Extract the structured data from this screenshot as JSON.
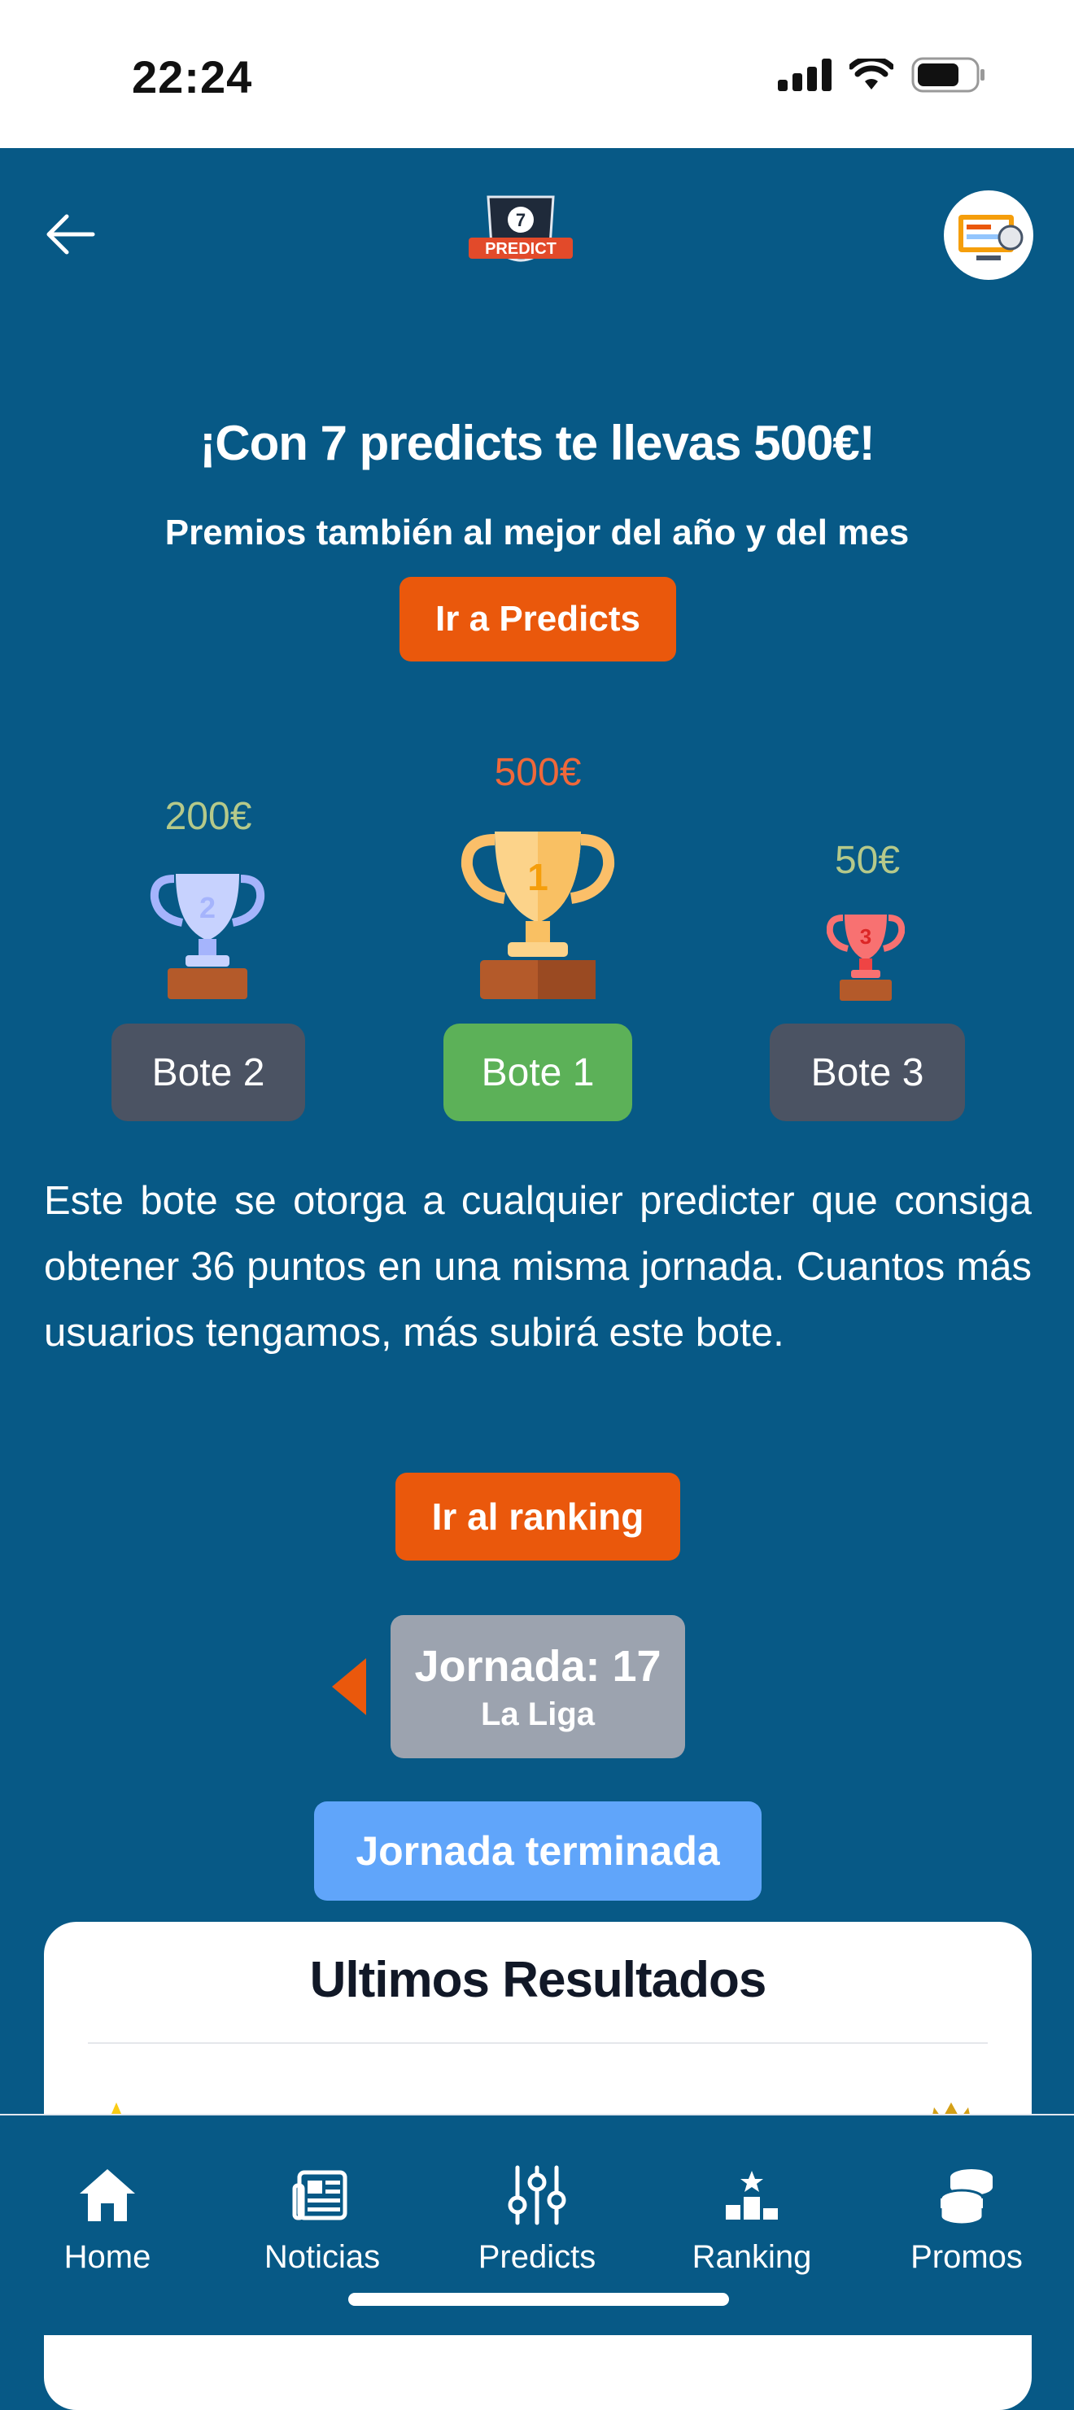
{
  "status_bar": {
    "time": "22:24"
  },
  "header": {
    "back_icon": "arrow-left-icon",
    "logo_text": "PREDICT",
    "logo_number": "7",
    "avatar_icon": "user-avatar-icon"
  },
  "promo": {
    "headline": "¡Con 7 predicts te llevas 500€!",
    "subline": "Premios también al mejor del año y del mes",
    "predicts_button": "Ir a Predicts"
  },
  "prizes": [
    {
      "amount": "200€",
      "label": "Bote 2",
      "rank": "2"
    },
    {
      "amount": "500€",
      "label": "Bote 1",
      "rank": "1"
    },
    {
      "amount": "50€",
      "label": "Bote 3",
      "rank": "3"
    }
  ],
  "selected_bote": "Bote 1",
  "description": "Este bote se otorga a cualquier predicter que consiga obtener 36 puntos en una misma jornada. Cuantos más usuarios tengamos, más subirá este bote.",
  "ranking_button": "Ir al ranking",
  "jornada": {
    "label": "Jornada: 17",
    "league": "La Liga",
    "status_button": "Jornada terminada"
  },
  "results": {
    "title": "Ultimos Resultados"
  },
  "tabbar": [
    {
      "label": "Home",
      "icon": "home-icon"
    },
    {
      "label": "Noticias",
      "icon": "newspaper-icon"
    },
    {
      "label": "Predicts",
      "icon": "sliders-icon"
    },
    {
      "label": "Ranking",
      "icon": "podium-icon"
    },
    {
      "label": "Promos",
      "icon": "coins-icon"
    }
  ],
  "colors": {
    "background": "#075986",
    "accent": "#ea580c",
    "bote_selected": "#5cb158",
    "bote_default": "#4b5363"
  }
}
